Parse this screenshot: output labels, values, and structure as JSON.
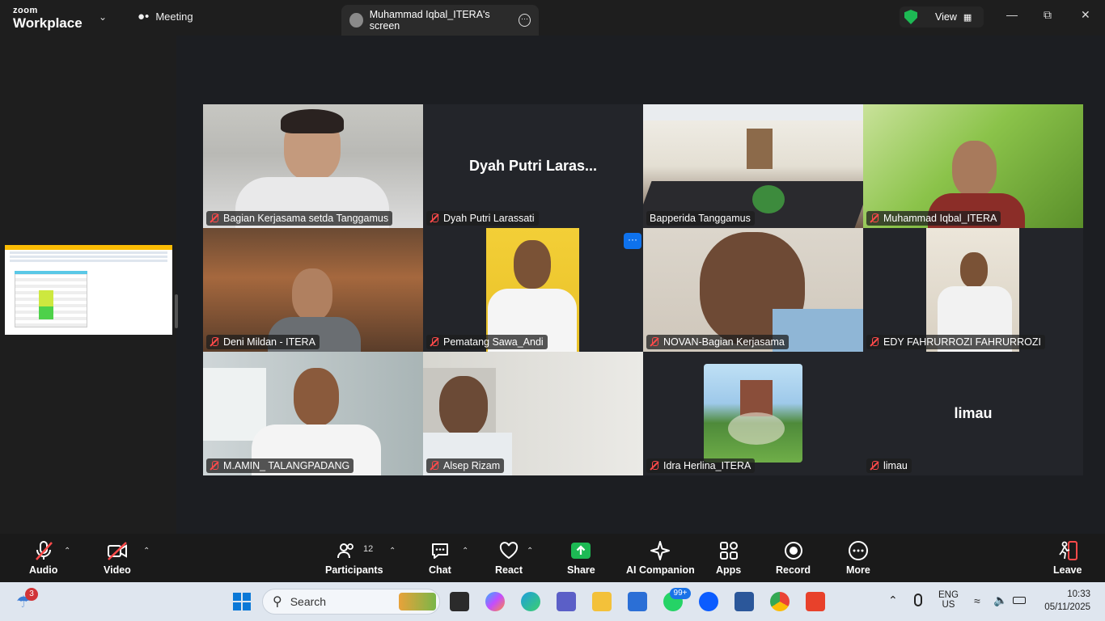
{
  "titlebar": {
    "logo_line1": "zoom",
    "logo_line2": "Workplace",
    "meeting_tab": "Meeting",
    "screen_tab": "Muhammad Iqbal_ITERA's screen",
    "view_label": "View"
  },
  "participants": [
    {
      "name": "Bagian Kerjasama setda Tanggamus",
      "video": true,
      "muted": true
    },
    {
      "name": "Dyah Putri Larassati",
      "display": "Dyah Putri Laras...",
      "video": false,
      "muted": true
    },
    {
      "name": "Bapperida Tanggamus",
      "video": true,
      "muted": false,
      "active_speaker": true
    },
    {
      "name": "Muhammad Iqbal_ITERA",
      "video": true,
      "muted": true
    },
    {
      "name": "Deni Mildan - ITERA",
      "video": true,
      "muted": true
    },
    {
      "name": "Pematang Sawa_Andi",
      "video": true,
      "muted": true
    },
    {
      "name": "NOVAN-Bagian Kerjasama",
      "video": true,
      "muted": true
    },
    {
      "name": "EDY FAHRURROZI FAHRURROZI",
      "video": true,
      "muted": true
    },
    {
      "name": "M.AMIN_ TALANGPADANG",
      "video": true,
      "muted": true
    },
    {
      "name": "Alsep Rizam",
      "video": true,
      "muted": true
    },
    {
      "name": "Idra Herlina_ITERA",
      "video": true,
      "muted": true
    },
    {
      "name": "limau",
      "display": "limau",
      "video": false,
      "muted": true
    }
  ],
  "toolbar": {
    "audio": "Audio",
    "video": "Video",
    "participants": "Participants",
    "participants_count": "12",
    "chat": "Chat",
    "react": "React",
    "share": "Share",
    "ai_companion": "AI Companion",
    "apps": "Apps",
    "record": "Record",
    "more": "More",
    "leave": "Leave"
  },
  "taskbar": {
    "weather_badge": "3",
    "search_placeholder": "Search",
    "whatsapp_badge": "99+",
    "lang_line1": "ENG",
    "lang_line2": "US",
    "time": "10:33",
    "date": "05/11/2025"
  },
  "colors": {
    "active_speaker": "#23d18b",
    "share_green": "#1db954",
    "mute_red": "#ff4a4a",
    "accent_blue": "#0e72ed"
  }
}
